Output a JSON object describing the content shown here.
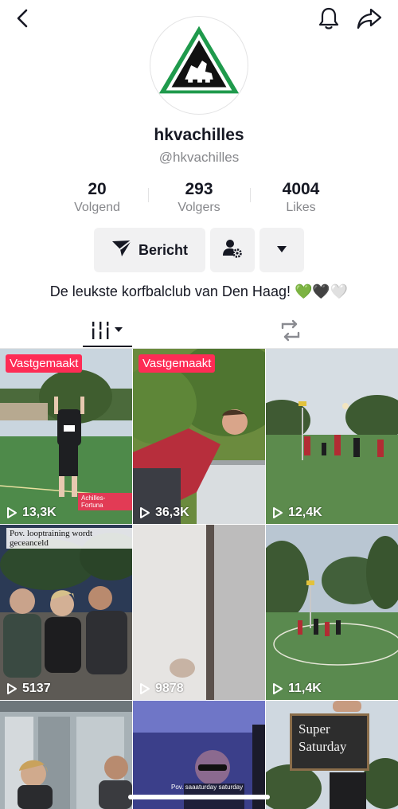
{
  "profile": {
    "username": "hkvachilles",
    "handle": "@hkvachilles",
    "bio": "De leukste korfbalclub van Den Haag! 💚🖤🤍"
  },
  "stats": [
    {
      "value": "20",
      "label": "Volgend"
    },
    {
      "value": "293",
      "label": "Volgers"
    },
    {
      "value": "4004",
      "label": "Likes"
    }
  ],
  "actions": {
    "message_label": "Bericht"
  },
  "icons": {
    "back": "chevron-left-icon",
    "bell": "bell-icon",
    "share": "share-arrow-icon",
    "message": "paper-plane-icon",
    "follow_settings": "user-gear-icon",
    "more": "caret-down-icon",
    "grid_tab": "grid-tab-icon",
    "repost_tab": "repost-icon"
  },
  "videos": [
    {
      "pinned_label": "Vastgemaakt",
      "views": "13,3K",
      "tag": "Achilles- Fortuna"
    },
    {
      "pinned_label": "Vastgemaakt",
      "views": "36,3K"
    },
    {
      "views": "12,4K"
    },
    {
      "views": "5137",
      "caption": "Pov. looptraining wordt geceanceld"
    },
    {
      "views": "9878"
    },
    {
      "views": "11,4K"
    },
    {},
    {
      "overlay": "Pov. saaaturday saturday"
    },
    {
      "sign": "Super Saturday"
    }
  ],
  "colors": {
    "accent": "#fe2c55",
    "text": "#161823",
    "muted": "#86878b",
    "button_bg": "#f1f1f2",
    "logo_green": "#1f9a4c"
  }
}
